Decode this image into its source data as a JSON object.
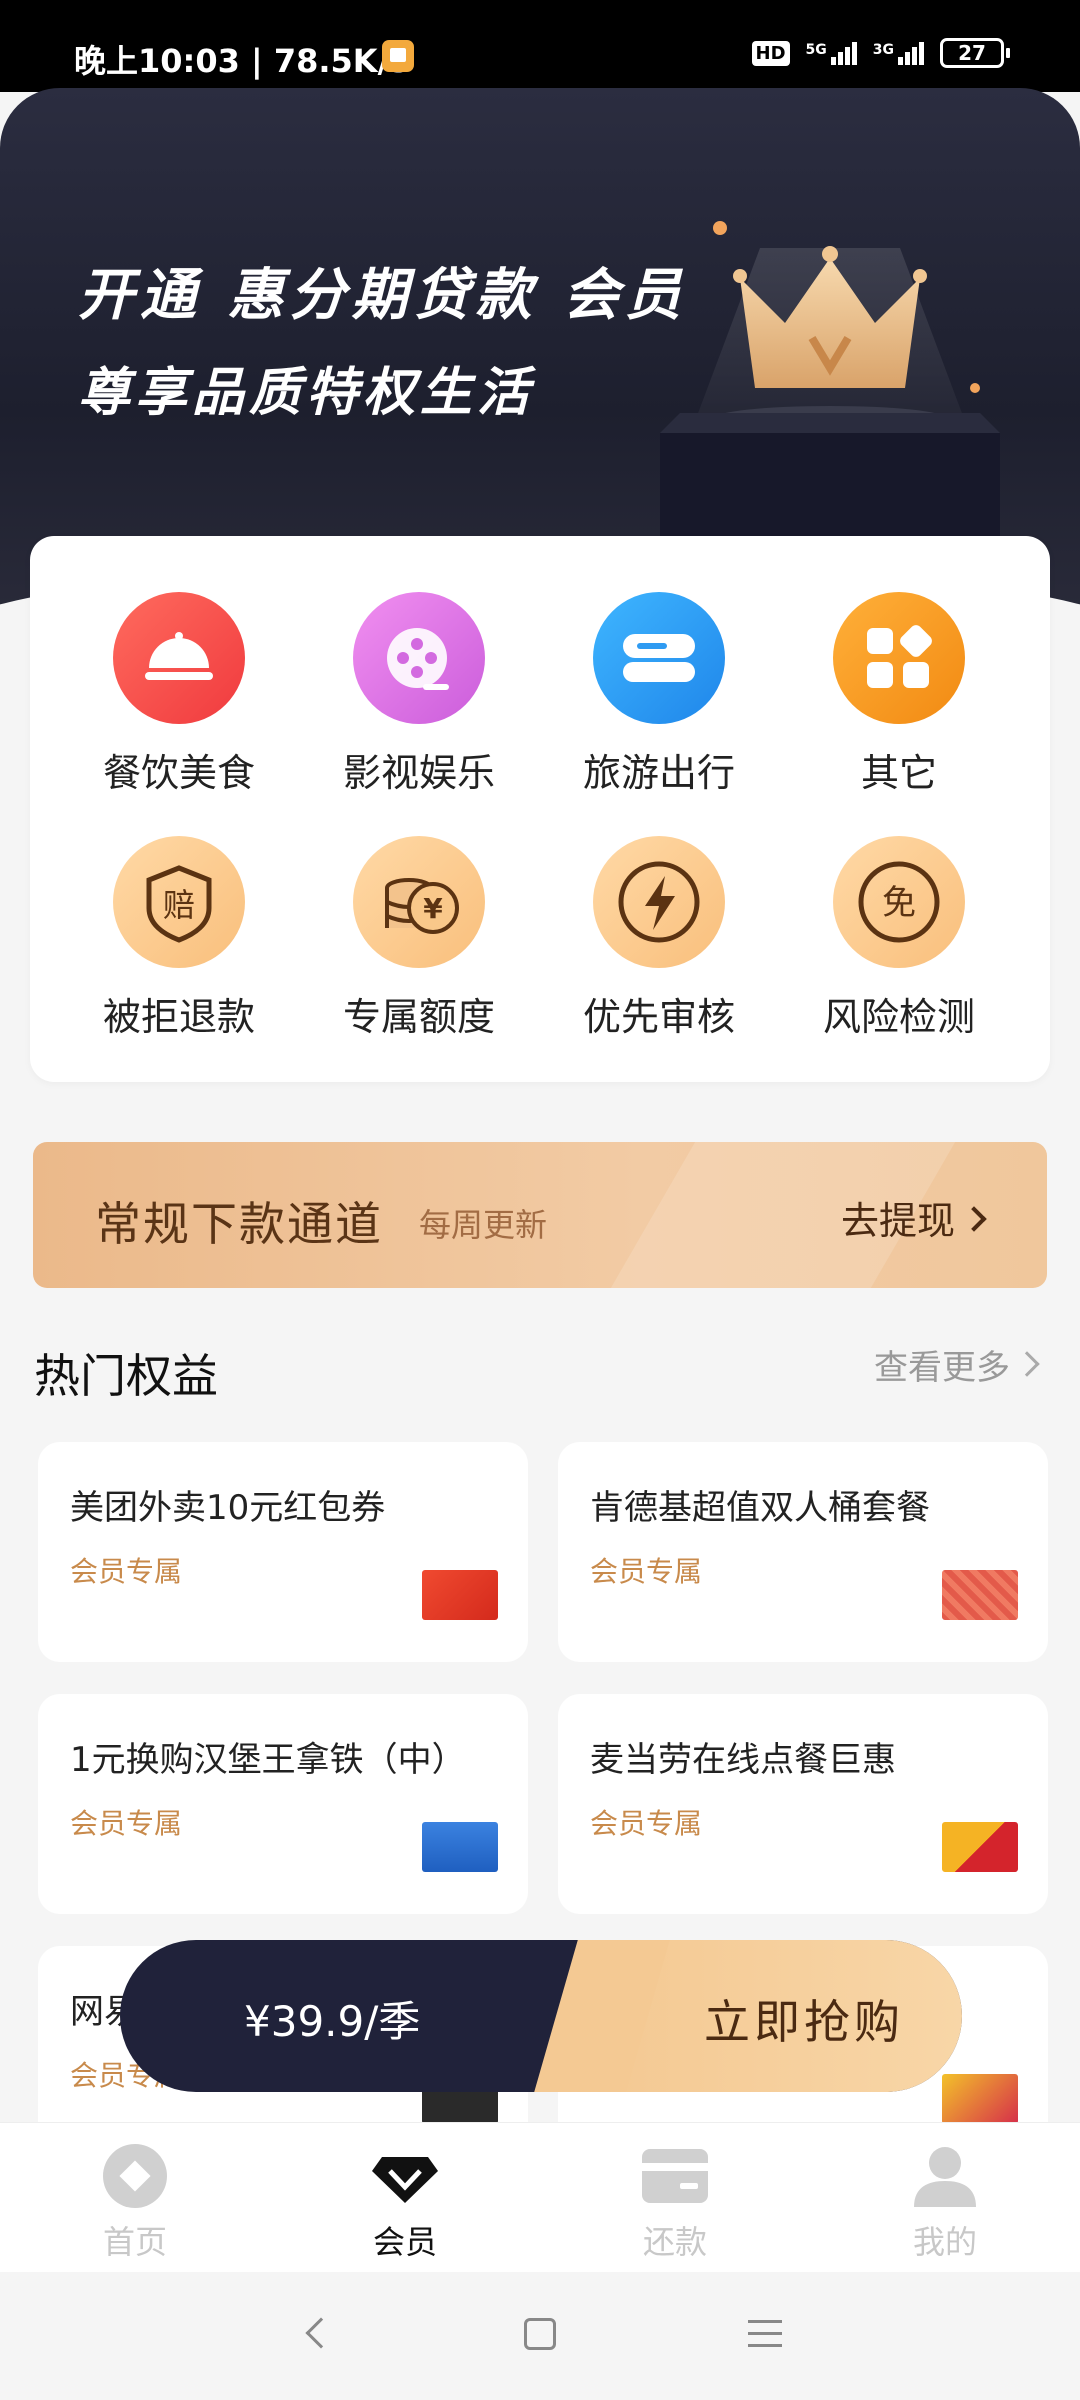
{
  "status_bar": {
    "time_speed": "晚上10:03 | 78.5K/s",
    "hd": "HD",
    "net1": "5G",
    "net2": "3G",
    "battery": "27"
  },
  "hero": {
    "line1": "开通 惠分期贷款 会员",
    "line2": "尊享品质特权生活"
  },
  "categories": [
    {
      "label": "餐饮美食",
      "icon": "dining-icon",
      "color": "#f3544f"
    },
    {
      "label": "影视娱乐",
      "icon": "film-reel-icon",
      "color": "#e178e6"
    },
    {
      "label": "旅游出行",
      "icon": "travel-icon",
      "color": "#2f9bf2"
    },
    {
      "label": "其它",
      "icon": "grid-icon",
      "color": "#f59a22"
    },
    {
      "label": "被拒退款",
      "icon": "refund-shield-icon",
      "color": "#fccb8c",
      "glyph": "赔"
    },
    {
      "label": "专属额度",
      "icon": "coins-icon",
      "color": "#fccb8c",
      "glyph": "¥"
    },
    {
      "label": "优先审核",
      "icon": "lightning-icon",
      "color": "#fccb8c"
    },
    {
      "label": "风险检测",
      "icon": "risk-check-icon",
      "color": "#fccb8c",
      "glyph": "免"
    }
  ],
  "channel": {
    "title": "常规下款通道",
    "subtitle": "每周更新",
    "button": "去提现"
  },
  "hot": {
    "title": "热门权益",
    "more": "查看更多"
  },
  "benefits": [
    {
      "title": "美团外卖10元红包券",
      "tag": "会员专属",
      "thumb_color": "#e8392b"
    },
    {
      "title": "肯德基超值双人桶套餐",
      "tag": "会员专属",
      "thumb_color": "#e35a4a"
    },
    {
      "title": "1元换购汉堡王拿铁（中）",
      "tag": "会员专属",
      "thumb_color": "#2f6fd0"
    },
    {
      "title": "麦当劳在线点餐巨惠",
      "tag": "会员专属",
      "thumb_color": "#f5b324"
    },
    {
      "title": "网易",
      "tag": "会员专属",
      "thumb_color": "#2a2a2a"
    },
    {
      "title": "",
      "tag": "",
      "thumb_color": "#d62f4a"
    }
  ],
  "buy": {
    "price": "¥39.9/季",
    "cta": "立即抢购"
  },
  "tabs": [
    {
      "label": "首页",
      "icon": "home-icon"
    },
    {
      "label": "会员",
      "icon": "vip-diamond-icon",
      "active": true
    },
    {
      "label": "还款",
      "icon": "card-icon"
    },
    {
      "label": "我的",
      "icon": "profile-icon"
    }
  ]
}
